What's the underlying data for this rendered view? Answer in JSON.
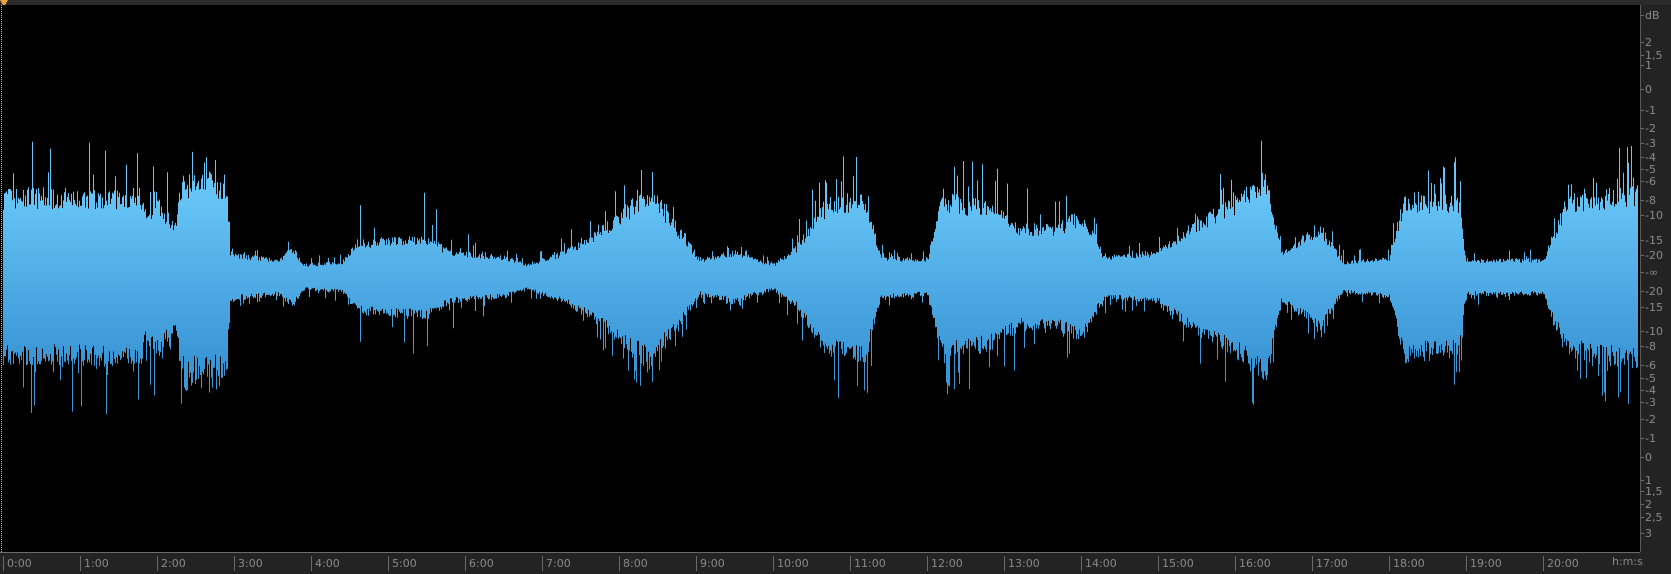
{
  "db_ruler": {
    "unit": "dB",
    "labels": [
      {
        "text": "2",
        "db": 2,
        "half": "top"
      },
      {
        "text": "1,5",
        "db": 1.5,
        "half": "top"
      },
      {
        "text": "1",
        "db": 1,
        "half": "top"
      },
      {
        "text": "0",
        "db": 0,
        "half": "top"
      },
      {
        "text": "-1",
        "db": -1,
        "half": "top"
      },
      {
        "text": "-2",
        "db": -2,
        "half": "top"
      },
      {
        "text": "-3",
        "db": -3,
        "half": "top"
      },
      {
        "text": "-4",
        "db": -4,
        "half": "top"
      },
      {
        "text": "-5",
        "db": -5,
        "half": "top"
      },
      {
        "text": "-6",
        "db": -6,
        "half": "top"
      },
      {
        "text": "-8",
        "db": -8,
        "half": "top"
      },
      {
        "text": "-10",
        "db": -10,
        "half": "top"
      },
      {
        "text": "-15",
        "db": -15,
        "half": "top"
      },
      {
        "text": "-20",
        "db": -20,
        "half": "top"
      },
      {
        "text": "-∞",
        "db": null,
        "half": "center"
      },
      {
        "text": "-20",
        "db": -20,
        "half": "bottom"
      },
      {
        "text": "-15",
        "db": -15,
        "half": "bottom"
      },
      {
        "text": "-10",
        "db": -10,
        "half": "bottom"
      },
      {
        "text": "-8",
        "db": -8,
        "half": "bottom"
      },
      {
        "text": "-6",
        "db": -6,
        "half": "bottom"
      },
      {
        "text": "-5",
        "db": -5,
        "half": "bottom"
      },
      {
        "text": "-4",
        "db": -4,
        "half": "bottom"
      },
      {
        "text": "-3",
        "db": -3,
        "half": "bottom"
      },
      {
        "text": "-2",
        "db": -2,
        "half": "bottom"
      },
      {
        "text": "-1",
        "db": -1,
        "half": "bottom"
      },
      {
        "text": "0",
        "db": 0,
        "half": "bottom"
      },
      {
        "text": "1",
        "db": 1,
        "half": "bottom"
      },
      {
        "text": "1,5",
        "db": 1.5,
        "half": "bottom"
      },
      {
        "text": "2",
        "db": 2,
        "half": "bottom"
      },
      {
        "text": "2,5",
        "db": 2.5,
        "half": "bottom"
      },
      {
        "text": "3",
        "db": 3,
        "half": "bottom"
      }
    ]
  },
  "time_ruler": {
    "unit": "h:m:s",
    "labels": [
      "0:00",
      "1:00",
      "2:00",
      "3:00",
      "4:00",
      "5:00",
      "6:00",
      "7:00",
      "8:00",
      "9:00",
      "10:00",
      "11:00",
      "12:00",
      "13:00",
      "14:00",
      "15:00",
      "16:00",
      "17:00",
      "18:00",
      "19:00",
      "20:00"
    ]
  },
  "waveform": {
    "color_top": "#66c4f6",
    "color_bottom": "#3b96d6",
    "duration_min": 21.3,
    "envelope": [
      [
        0,
        0.33,
        0.52
      ],
      [
        1.8,
        0.33,
        0.5
      ],
      [
        1.85,
        0.25,
        0.4
      ],
      [
        2.0,
        0.3,
        0.45
      ],
      [
        2.25,
        0.2,
        0.35
      ],
      [
        2.3,
        0.38,
        0.47
      ],
      [
        2.9,
        0.38,
        0.45
      ],
      [
        2.95,
        0.09,
        0.12
      ],
      [
        3.6,
        0.07,
        0.1
      ],
      [
        3.75,
        0.12,
        0.16
      ],
      [
        3.9,
        0.05,
        0.07
      ],
      [
        4.4,
        0.06,
        0.1
      ],
      [
        4.6,
        0.14,
        0.3
      ],
      [
        5.5,
        0.16,
        0.32
      ],
      [
        5.8,
        0.1,
        0.2
      ],
      [
        6.5,
        0.08,
        0.12
      ],
      [
        6.8,
        0.05,
        0.07
      ],
      [
        7.3,
        0.1,
        0.16
      ],
      [
        7.8,
        0.2,
        0.3
      ],
      [
        8.4,
        0.35,
        0.44
      ],
      [
        8.7,
        0.22,
        0.3
      ],
      [
        9.05,
        0.07,
        0.1
      ],
      [
        9.5,
        0.1,
        0.13
      ],
      [
        10.0,
        0.05,
        0.07
      ],
      [
        10.3,
        0.12,
        0.2
      ],
      [
        10.7,
        0.3,
        0.45
      ],
      [
        11.2,
        0.32,
        0.48
      ],
      [
        11.4,
        0.08,
        0.12
      ],
      [
        12.0,
        0.07,
        0.1
      ],
      [
        12.2,
        0.32,
        0.45
      ],
      [
        12.8,
        0.28,
        0.42
      ],
      [
        13.2,
        0.2,
        0.35
      ],
      [
        13.7,
        0.2,
        0.3
      ],
      [
        14.0,
        0.25,
        0.35
      ],
      [
        14.3,
        0.08,
        0.14
      ],
      [
        15.0,
        0.1,
        0.16
      ],
      [
        15.4,
        0.2,
        0.3
      ],
      [
        16.0,
        0.3,
        0.42
      ],
      [
        16.4,
        0.4,
        0.52
      ],
      [
        16.6,
        0.1,
        0.15
      ],
      [
        17.1,
        0.2,
        0.26
      ],
      [
        17.4,
        0.06,
        0.1
      ],
      [
        18.0,
        0.08,
        0.12
      ],
      [
        18.2,
        0.32,
        0.45
      ],
      [
        18.9,
        0.3,
        0.44
      ],
      [
        19.0,
        0.07,
        0.1
      ],
      [
        20.0,
        0.07,
        0.12
      ],
      [
        20.3,
        0.3,
        0.42
      ],
      [
        21.3,
        0.35,
        0.5
      ]
    ]
  }
}
